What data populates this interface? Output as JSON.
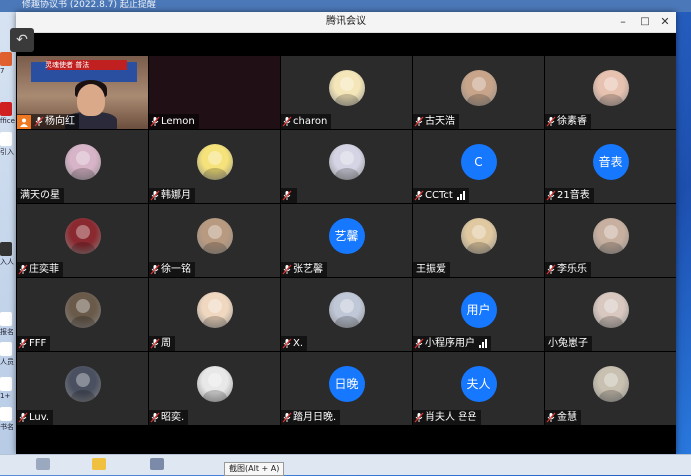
{
  "desktop": {
    "top_text": "修趣协议书 (2022.8.7) 起止提醒",
    "left_icons": [
      "7",
      "ffice",
      "引入",
      "入人",
      "报名",
      "人员",
      "1+",
      "书名",
      "结入",
      "已"
    ],
    "tooltip": "截图(Alt + A)"
  },
  "window": {
    "title": "腾讯会议",
    "minimize_glyph": "–",
    "maximize_glyph": "□",
    "close_glyph": "✕"
  },
  "back_glyph": "↶",
  "video_banner": "灵魂使者  普法",
  "participants": [
    {
      "name": "杨向红",
      "avatar": "video",
      "muted": true,
      "host": true
    },
    {
      "name": "Lemon",
      "avatar": "none",
      "muted": true
    },
    {
      "name": "charon",
      "avatar": "img",
      "color": "#f4e6b8",
      "muted": true
    },
    {
      "name": "古天浩",
      "avatar": "img",
      "color": "#c8a58a",
      "muted": true
    },
    {
      "name": "徐素睿",
      "avatar": "img",
      "color": "#e8c2b0",
      "muted": true
    },
    {
      "name": "满天の星",
      "avatar": "img",
      "color": "#d8b4c8",
      "muted": false
    },
    {
      "name": "韩娜月",
      "avatar": "img",
      "color": "#f5e27a",
      "muted": true
    },
    {
      "name": "",
      "avatar": "img",
      "color": "#d4d4e4",
      "muted": true
    },
    {
      "name": "CCTct",
      "avatar": "text",
      "text": "C",
      "muted": true,
      "signal": true
    },
    {
      "name": "21音表",
      "avatar": "text",
      "text": "音表",
      "muted": true
    },
    {
      "name": "庄奕菲",
      "avatar": "img",
      "color": "#8a2a30",
      "muted": true
    },
    {
      "name": "徐一铭",
      "avatar": "img",
      "color": "#b89a80",
      "muted": true
    },
    {
      "name": "张艺馨",
      "avatar": "text",
      "text": "艺馨",
      "muted": true
    },
    {
      "name": "王振爱",
      "avatar": "img",
      "color": "#e0c8a0",
      "muted": false
    },
    {
      "name": "李乐乐",
      "avatar": "img",
      "color": "#c8b0a0",
      "muted": true
    },
    {
      "name": "FFF",
      "avatar": "img",
      "color": "#6a5a4a",
      "muted": true
    },
    {
      "name": "周",
      "avatar": "img",
      "color": "#f0d8c0",
      "muted": true
    },
    {
      "name": "X.",
      "avatar": "img",
      "color": "#c0c8d8",
      "muted": true
    },
    {
      "name": "小程序用户",
      "avatar": "text",
      "text": "用户",
      "muted": true,
      "signal": true
    },
    {
      "name": "小兔崽子",
      "avatar": "img",
      "color": "#d8c8c0",
      "muted": false
    },
    {
      "name": "Luv.",
      "avatar": "img",
      "color": "#4a5060",
      "muted": true
    },
    {
      "name": "昭奕.",
      "avatar": "img",
      "color": "#e8e8e8",
      "muted": true
    },
    {
      "name": "踏月日晚.",
      "avatar": "text",
      "text": "日晚",
      "muted": true
    },
    {
      "name": "肖夫人 욘욘",
      "avatar": "text",
      "text": "夫人",
      "muted": true
    },
    {
      "name": "金慧",
      "avatar": "img",
      "color": "#c8c0b0",
      "muted": true
    }
  ]
}
